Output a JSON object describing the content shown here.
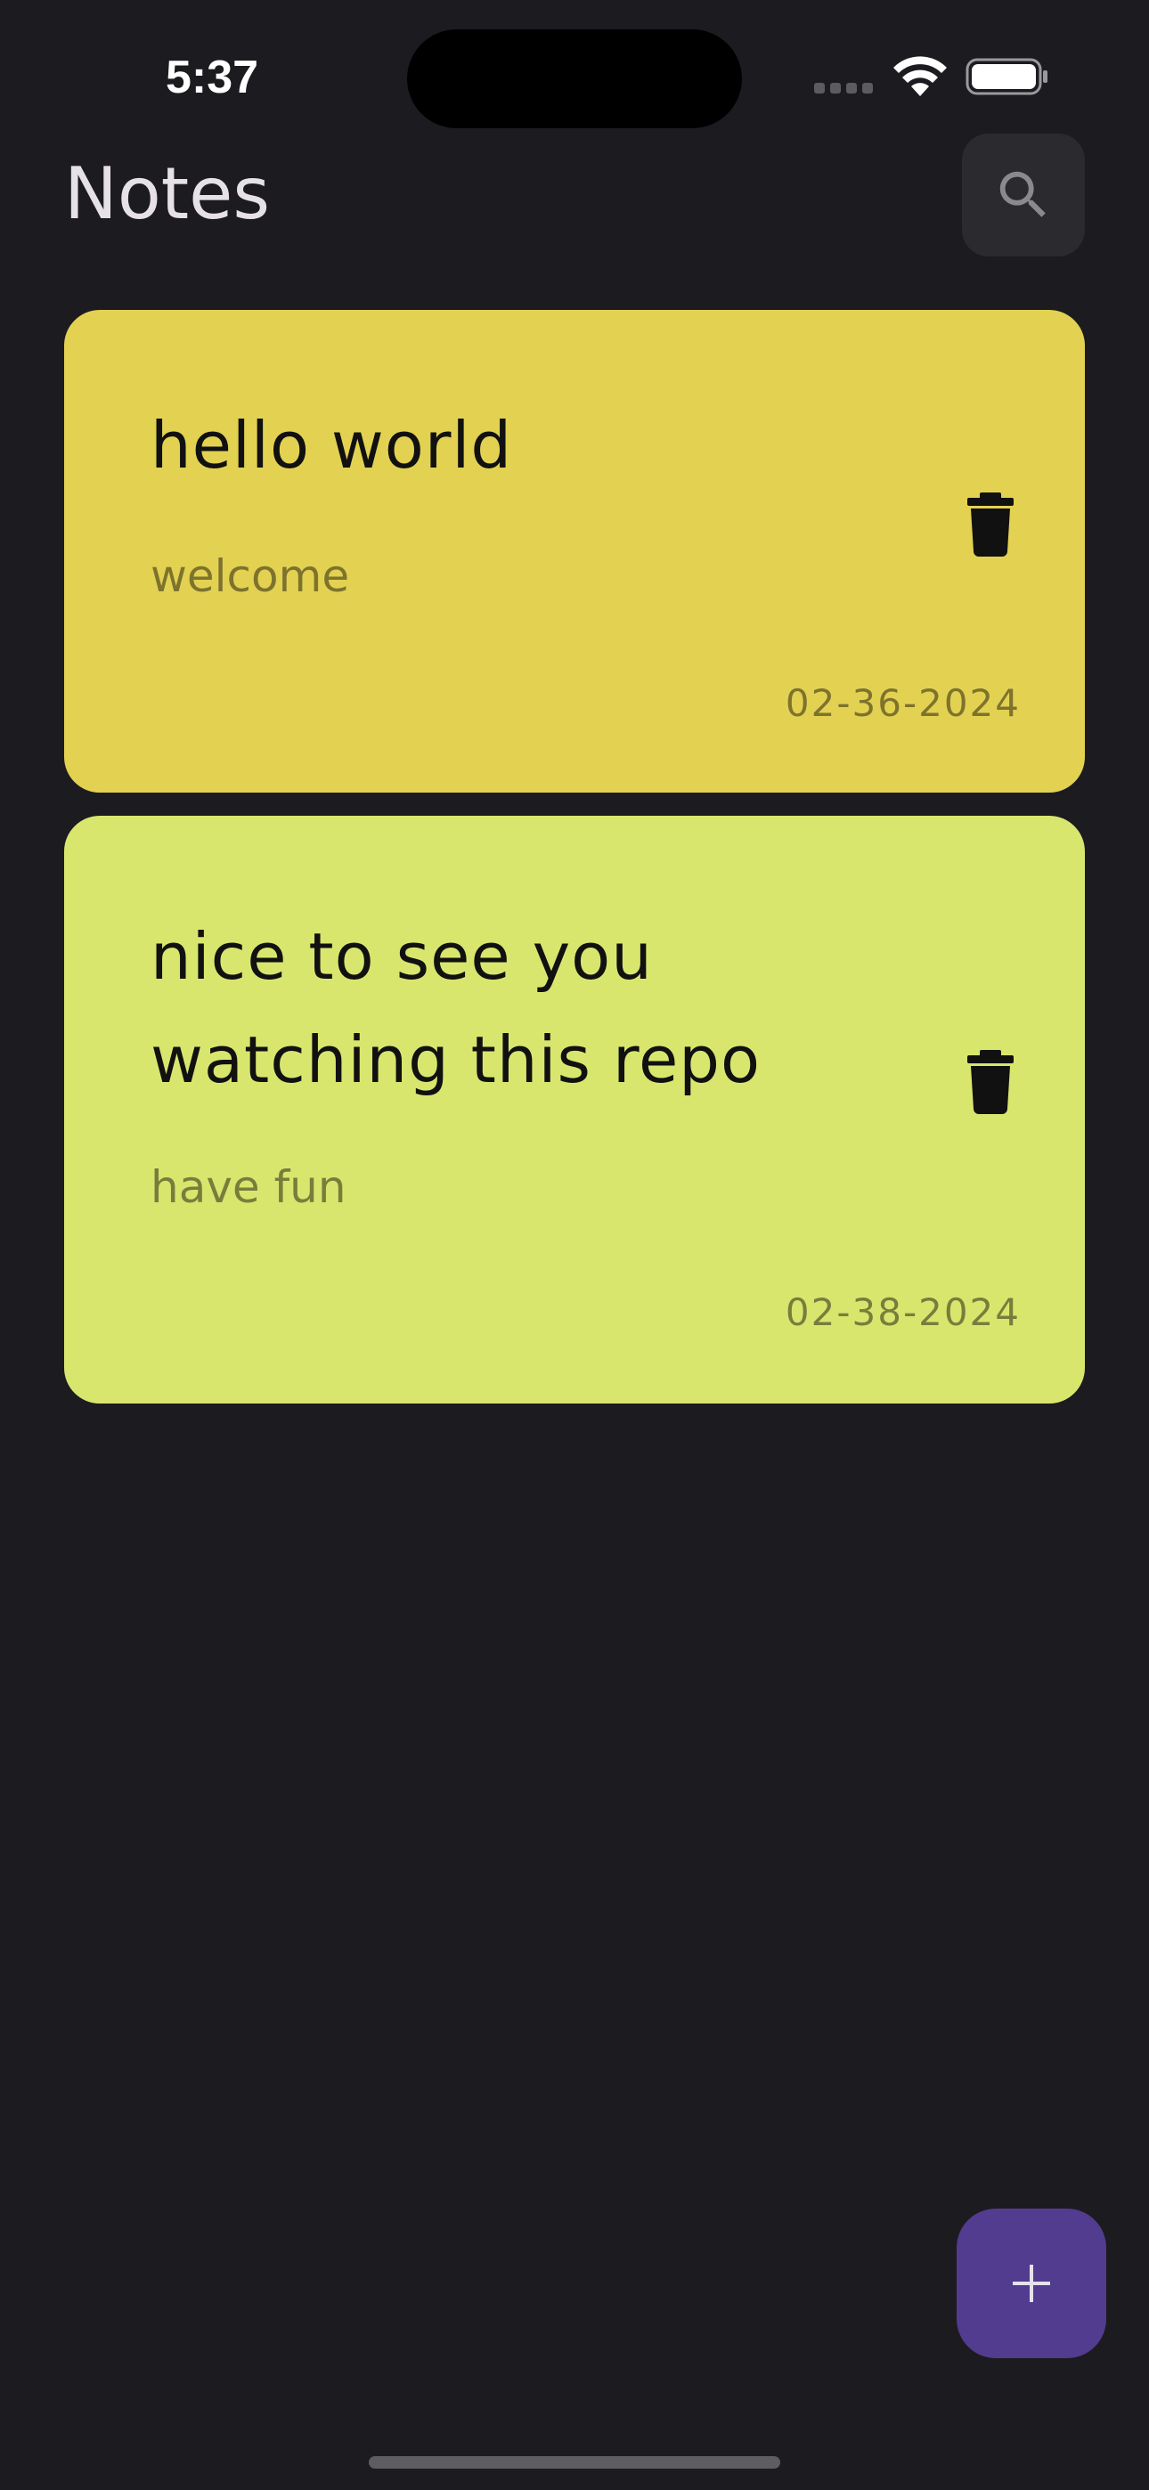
{
  "status_bar": {
    "time": "5:37"
  },
  "header": {
    "title": "Notes",
    "search_icon": "search-icon"
  },
  "notes": [
    {
      "title": "hello world",
      "subtitle": "welcome",
      "date": "02-36-2024",
      "color": "#e3d152",
      "delete_icon": "trash-icon"
    },
    {
      "title": "nice to see you watching this repo",
      "subtitle": "have fun",
      "date": "02-38-2024",
      "color": "#d9e66e",
      "delete_icon": "trash-icon"
    }
  ],
  "fab": {
    "icon": "plus-icon",
    "color": "#523c8f"
  },
  "colors": {
    "background": "#1c1b20",
    "accent": "#523c8f"
  }
}
